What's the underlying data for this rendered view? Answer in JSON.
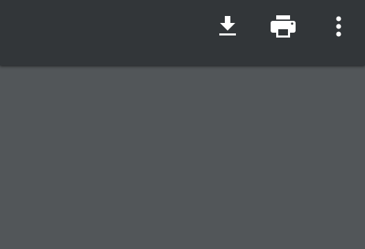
{
  "toolbar": {
    "actions": [
      {
        "name": "download",
        "icon": "download-icon"
      },
      {
        "name": "print",
        "icon": "print-icon"
      },
      {
        "name": "more",
        "icon": "more-vert-icon"
      }
    ]
  },
  "colors": {
    "toolbar_bg": "#323639",
    "viewer_bg": "#525659",
    "icon": "#ffffff"
  }
}
